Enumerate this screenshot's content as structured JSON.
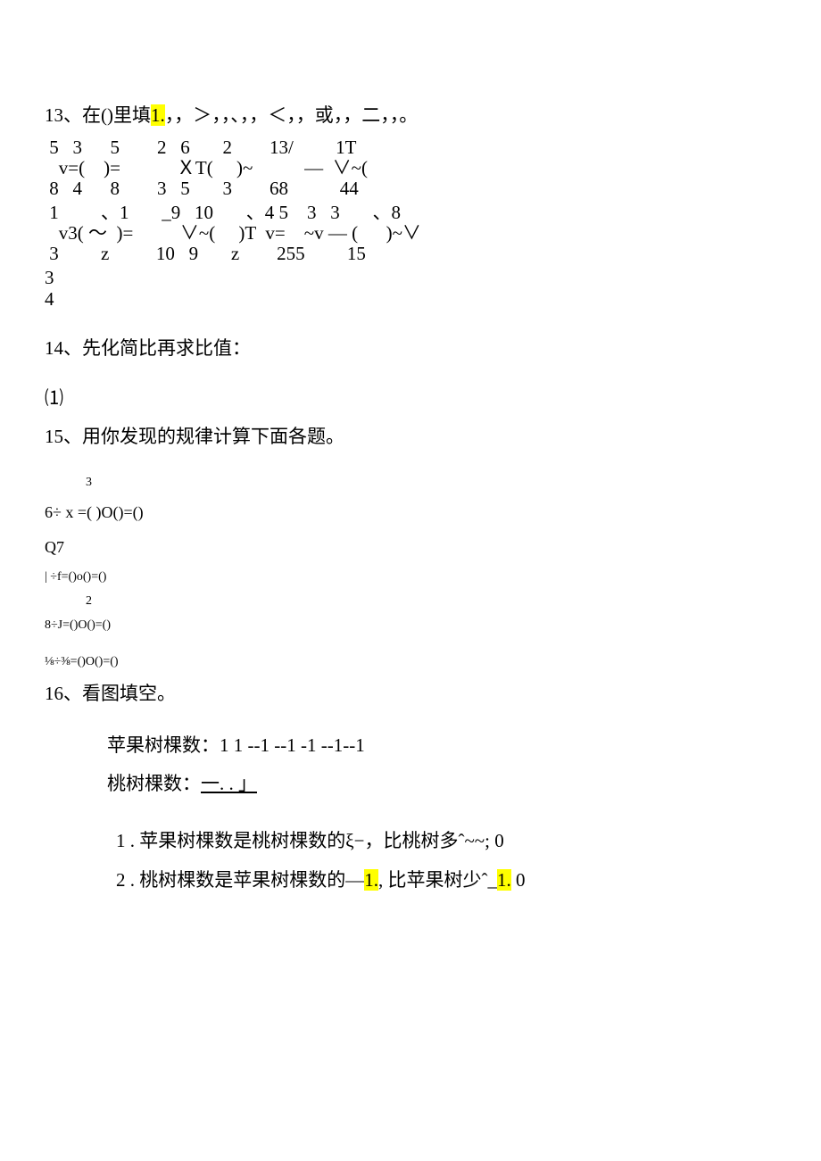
{
  "q13": {
    "intro_pre": "13、在()里填",
    "intro_hl": "1.",
    "intro_post": "，，＞，，、，，＜，，或，，二，，。",
    "row1a": " 5   3      5        2   6       2        13/         1T",
    "row1b": "   v=(    )=            ＸT(     )~           —  ∨~(",
    "row1c": " 8   4      8        3   5       3        68           44",
    "row2a": " 1         、1       _9   10       、4 5    3   3       、8",
    "row2b": "   v3( ～  )=          ∨~(     )T  v=    ~v — (      )~∨",
    "row2c": " 3         z          10   9       z        255         15",
    "row3a": "3",
    "row3b": "4"
  },
  "q14": {
    "text": "14、先化简比再求比值：",
    "sub": "⑴"
  },
  "q15": {
    "text": "15、用你发现的规律计算下面各题。",
    "line1_top": "3",
    "line1": "6÷ x =(          )O()=()",
    "line2": "Q7",
    "line3": "| ÷f=()o()=()",
    "line4_top": "2",
    "line4": "8÷J=()O()=()",
    "line5": "⅛÷⅜=()O()=()"
  },
  "q16": {
    "text": "16、看图填空。",
    "apple": "苹果树棵数：1  1 --1 --1 -1 --1--1",
    "peach_pre": "桃树棵数：",
    "peach_under": "一.                 .     」",
    "item1": "1 . 苹果树棵数是桃树棵数的ξ−，比桃树多ˆ~~; 0",
    "item2_pre": "2 . 桃树棵数是苹果树棵数的—",
    "item2_hl1": "1.",
    "item2_mid": ", 比苹果树少ˆ_",
    "item2_hl2": "1.",
    "item2_post": " 0"
  }
}
